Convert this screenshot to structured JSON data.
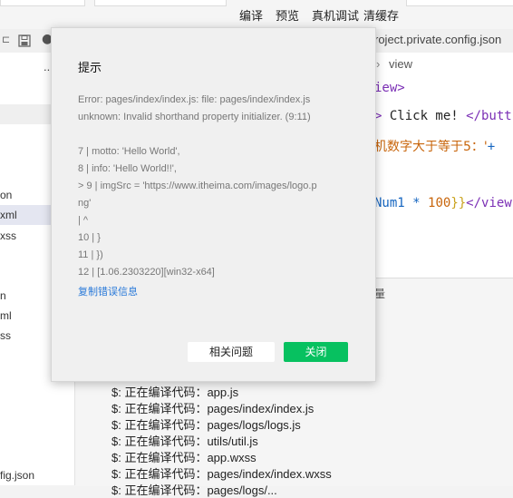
{
  "toolbar": {
    "compile": "编译",
    "preview": "预览",
    "device_debug": "真机调试",
    "clear_cache": "清缓存"
  },
  "icons": {
    "save": "save-icon",
    "settings": "settings-icon"
  },
  "explorer": {
    "ellipsis": "...",
    "items": [
      "on",
      "xml",
      "xss",
      "n",
      "ml",
      "ss",
      "fig.json"
    ],
    "selected_index": 1
  },
  "editor": {
    "tab_title": "roject.private.config.json",
    "breadcrumb_sep": "›",
    "breadcrumb": "view",
    "lines": {
      "l1": "iew>",
      "l2_a": "> ",
      "l2_b": "Click me!",
      "l2_c": " </butt",
      "l3_a": "机数字大于等于5：'",
      "l3_b": "+",
      "l4_a": "Num1",
      "l4_b": " * ",
      "l4_c": "100",
      "l4_d": "}}",
      "l4_e": "</view"
    }
  },
  "console": {
    "frag": "量",
    "lines": [
      "$: 正在编译代码：app.js",
      "$: 正在编译代码：pages/index/index.js",
      "$: 正在编译代码：pages/logs/logs.js",
      "$: 正在编译代码：utils/util.js",
      "$: 正在编译代码：app.wxss",
      "$: 正在编译代码：pages/index/index.wxss",
      "$: 正在编译代码：pages/logs/..."
    ]
  },
  "modal": {
    "title": "提示",
    "error_lines": [
      "Error: pages/index/index.js: file: pages/index/index.js",
      "unknown: Invalid shorthand property initializer. (9:11)"
    ],
    "code_lines": [
      "7 | motto: 'Hello World',",
      "8 | info: 'Hello World!!',",
      "> 9 | imgSrc = 'https://www.itheima.com/images/logo.p",
      "ng'",
      "| ^",
      "10 | }",
      "11 | })",
      "12 | [1.06.2303220][win32-x64]"
    ],
    "copy_link": "复制错误信息",
    "help_button": "相关问题",
    "close_button": "关闭"
  },
  "colors": {
    "accent_green": "#07c160",
    "link_blue": "#2a7ad9",
    "code_purple": "#7b2fb5",
    "code_orange": "#c8650b",
    "code_blue": "#1565c0"
  }
}
